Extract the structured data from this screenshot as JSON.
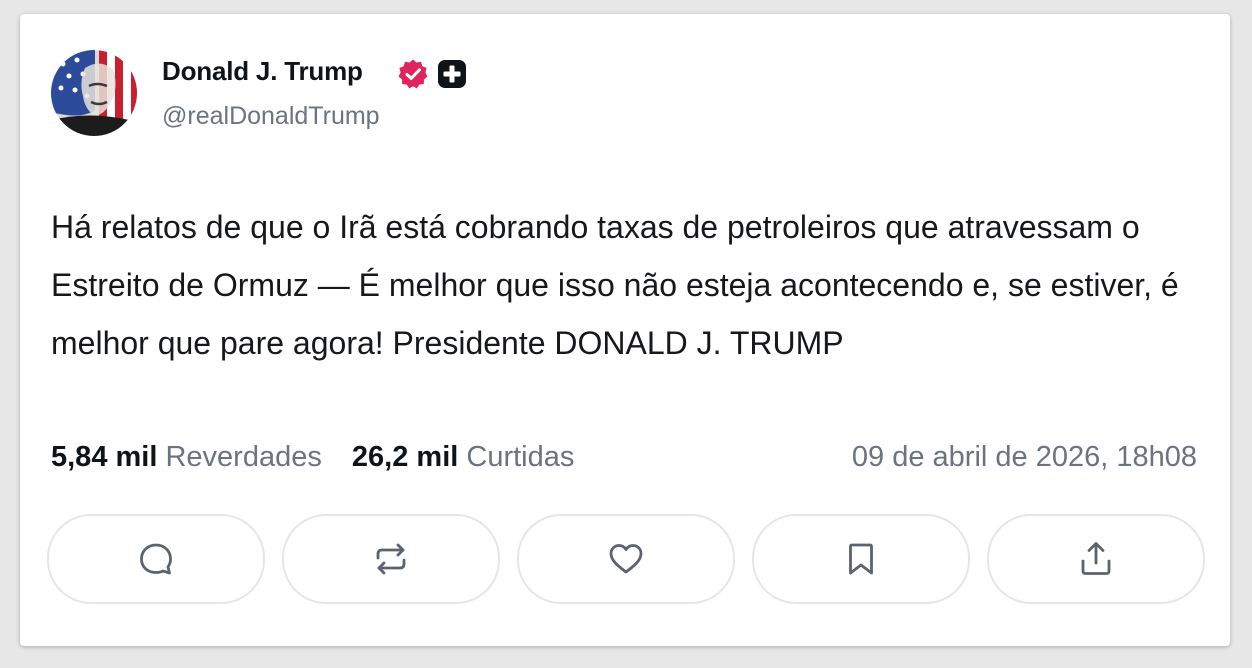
{
  "author": {
    "display_name": "Donald J. Trump",
    "handle": "@realDonaldTrump",
    "avatar_icon": "avatar-portrait-flag",
    "verified_icon": "verified-badge-icon",
    "verified_color": "#e0245e",
    "plus_icon": "plus-badge-icon"
  },
  "post": {
    "text": "Há relatos de que o Irã está cobrando taxas de petroleiros que atravessam o Estreito de Ormuz — É melhor que isso não esteja acontecendo e, se estiver, é melhor que pare agora! Presidente DONALD J. TRUMP"
  },
  "stats": {
    "reposts_count": "5,84 mil",
    "reposts_label": "Reverdades",
    "likes_count": "26,2 mil",
    "likes_label": "Curtidas",
    "timestamp": "09 de abril de 2026, 18h08"
  },
  "actions": [
    {
      "name": "reply",
      "icon": "comment-icon"
    },
    {
      "name": "repost",
      "icon": "repost-icon"
    },
    {
      "name": "like",
      "icon": "heart-icon"
    },
    {
      "name": "bookmark",
      "icon": "bookmark-icon"
    },
    {
      "name": "share",
      "icon": "share-icon"
    }
  ],
  "colors": {
    "text_primary": "#0f1419",
    "text_secondary": "#6b7282",
    "icon": "#5b6270",
    "border": "#e4e6ea"
  }
}
